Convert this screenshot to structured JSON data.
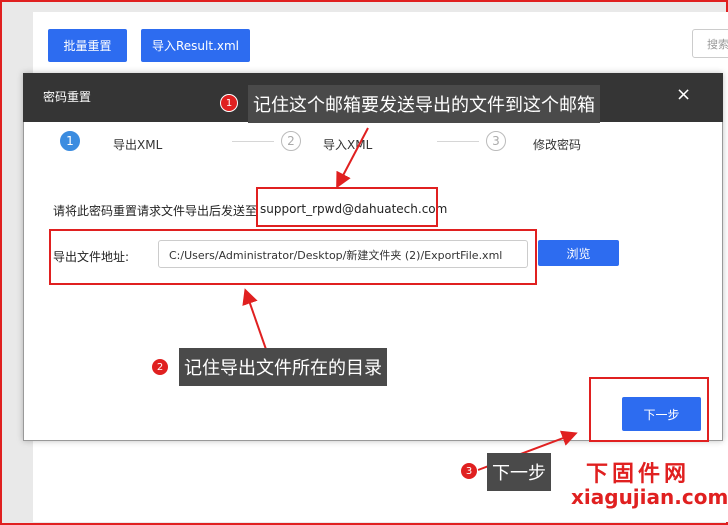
{
  "toolbar": {
    "batch_reset_label": "批量重置",
    "import_result_label": "导入Result.xml",
    "search_label": "搜索"
  },
  "dialog": {
    "title": "密码重置",
    "close_glyph": "×",
    "steps": [
      {
        "number": "1",
        "label": "导出XML",
        "state": "active"
      },
      {
        "number": "2",
        "label": "导入XML",
        "state": "idle"
      },
      {
        "number": "3",
        "label": "修改密码",
        "state": "idle"
      }
    ],
    "instruction": "请将此密码重置请求文件导出后发送至",
    "email": "support_rpwd@dahuatech.com",
    "path_label": "导出文件地址:",
    "path_value": "C:/Users/Administrator/Desktop/新建文件夹 (2)/ExportFile.xml",
    "browse_label": "浏览",
    "next_label": "下一步"
  },
  "annotations": {
    "callout_1": {
      "number": "1",
      "text": "记住这个邮箱要发送导出的文件到这个邮箱"
    },
    "callout_2": {
      "number": "2",
      "text": "记住导出文件所在的目录"
    },
    "callout_3": {
      "number": "3",
      "text": "下一步"
    }
  },
  "watermark": {
    "line1": "下固件网",
    "line2": "xiagujian.com"
  },
  "colors": {
    "primary": "#2d6cf0",
    "annotation_red": "#e02020",
    "header_dark": "#353535",
    "callout_bg": "#4a4a4a"
  }
}
